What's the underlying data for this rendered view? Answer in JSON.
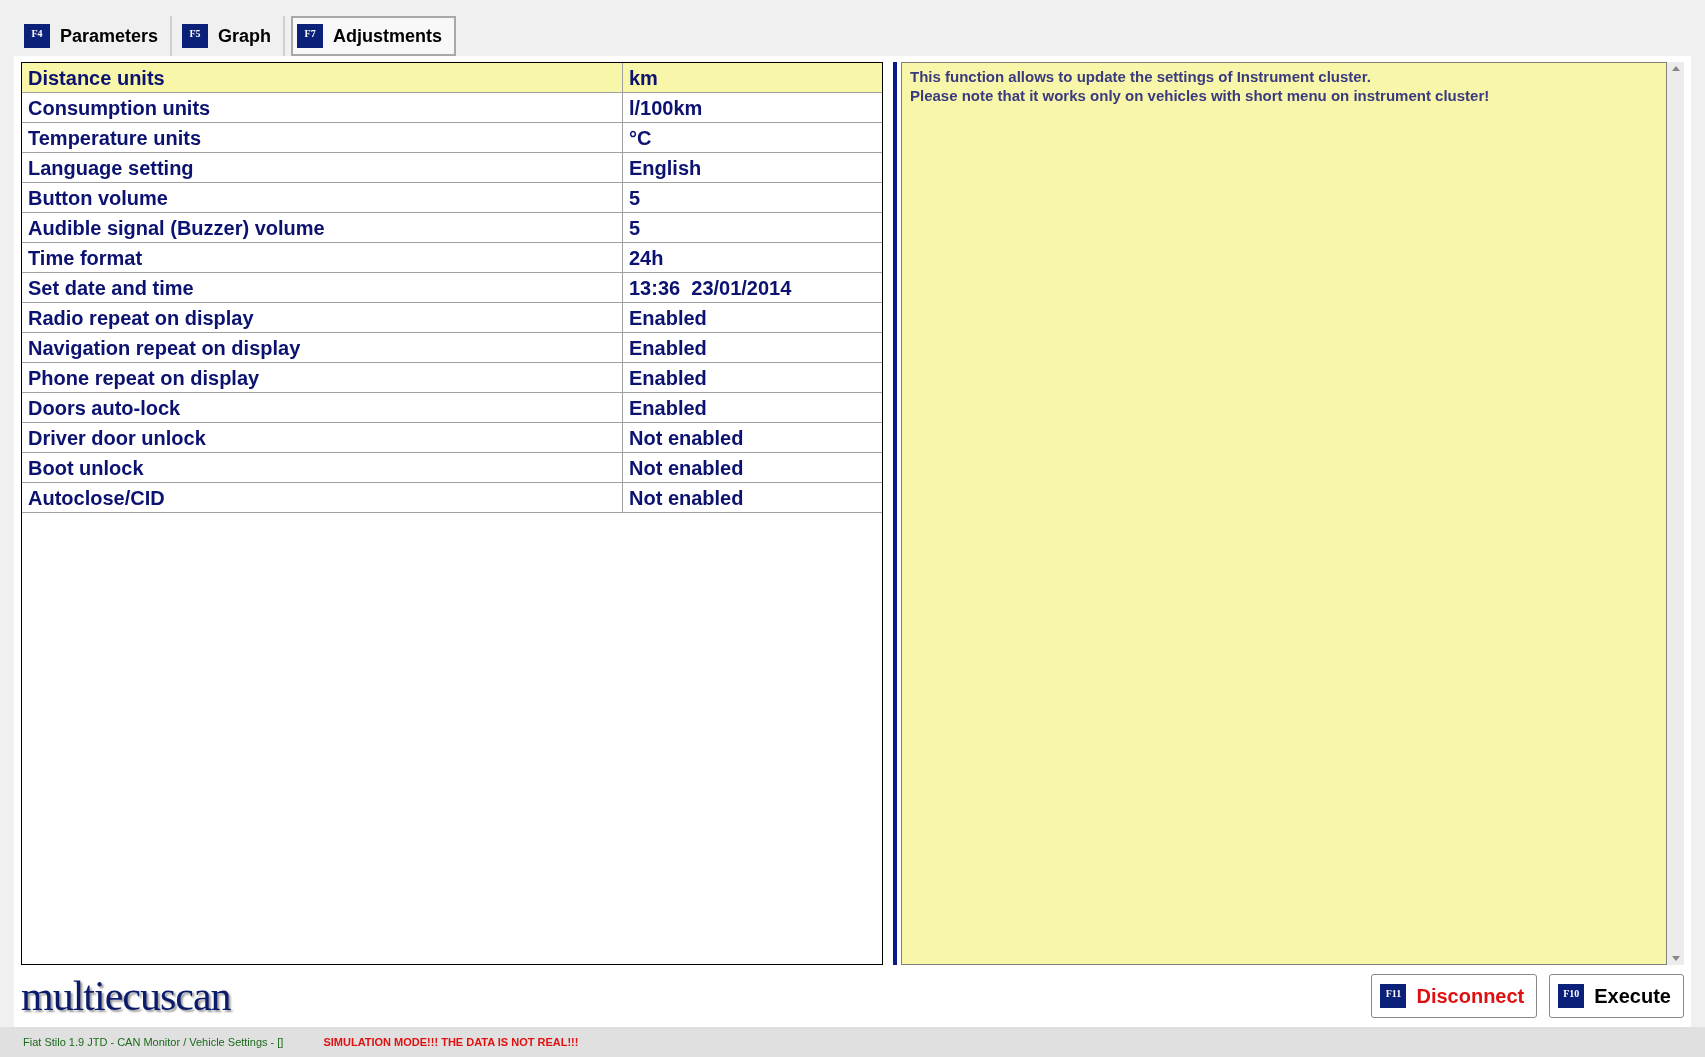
{
  "tabs": [
    {
      "key": "F4",
      "label": "Parameters",
      "selected": false
    },
    {
      "key": "F5",
      "label": "Graph",
      "selected": false
    },
    {
      "key": "F7",
      "label": "Adjustments",
      "selected": true
    }
  ],
  "table": {
    "rows": [
      {
        "name": "Distance units",
        "value": "km",
        "selected": true
      },
      {
        "name": "Consumption units",
        "value": "l/100km",
        "selected": false
      },
      {
        "name": "Temperature units",
        "value": "°C",
        "selected": false
      },
      {
        "name": "Language setting",
        "value": "English",
        "selected": false
      },
      {
        "name": "Button volume",
        "value": "5",
        "selected": false
      },
      {
        "name": "Audible signal (Buzzer) volume",
        "value": "5",
        "selected": false
      },
      {
        "name": "Time format",
        "value": "24h",
        "selected": false
      },
      {
        "name": "Set date and time",
        "value": "13:36  23/01/2014",
        "selected": false
      },
      {
        "name": "Radio repeat on display",
        "value": "Enabled",
        "selected": false
      },
      {
        "name": "Navigation repeat on display",
        "value": "Enabled",
        "selected": false
      },
      {
        "name": "Phone repeat on display",
        "value": "Enabled",
        "selected": false
      },
      {
        "name": "Doors auto-lock",
        "value": "Enabled",
        "selected": false
      },
      {
        "name": "Driver door unlock",
        "value": "Not enabled",
        "selected": false
      },
      {
        "name": "Boot unlock",
        "value": "Not enabled",
        "selected": false
      },
      {
        "name": "Autoclose/CID",
        "value": "Not enabled",
        "selected": false
      }
    ]
  },
  "info": {
    "lines": [
      "This function allows to update the settings of Instrument cluster.",
      "Please note that it works only on vehicles with short menu on instrument cluster!"
    ]
  },
  "logo": "multiecuscan",
  "buttons": [
    {
      "key": "F11",
      "label": "Disconnect",
      "kind": "danger"
    },
    {
      "key": "F10",
      "label": "Execute",
      "kind": "normal"
    }
  ],
  "status_bar": {
    "context": "Fiat Stilo 1.9 JTD - CAN Monitor / Vehicle Settings - []",
    "warning": "SIMULATION MODE!!! THE DATA IS NOT REAL!!!"
  }
}
